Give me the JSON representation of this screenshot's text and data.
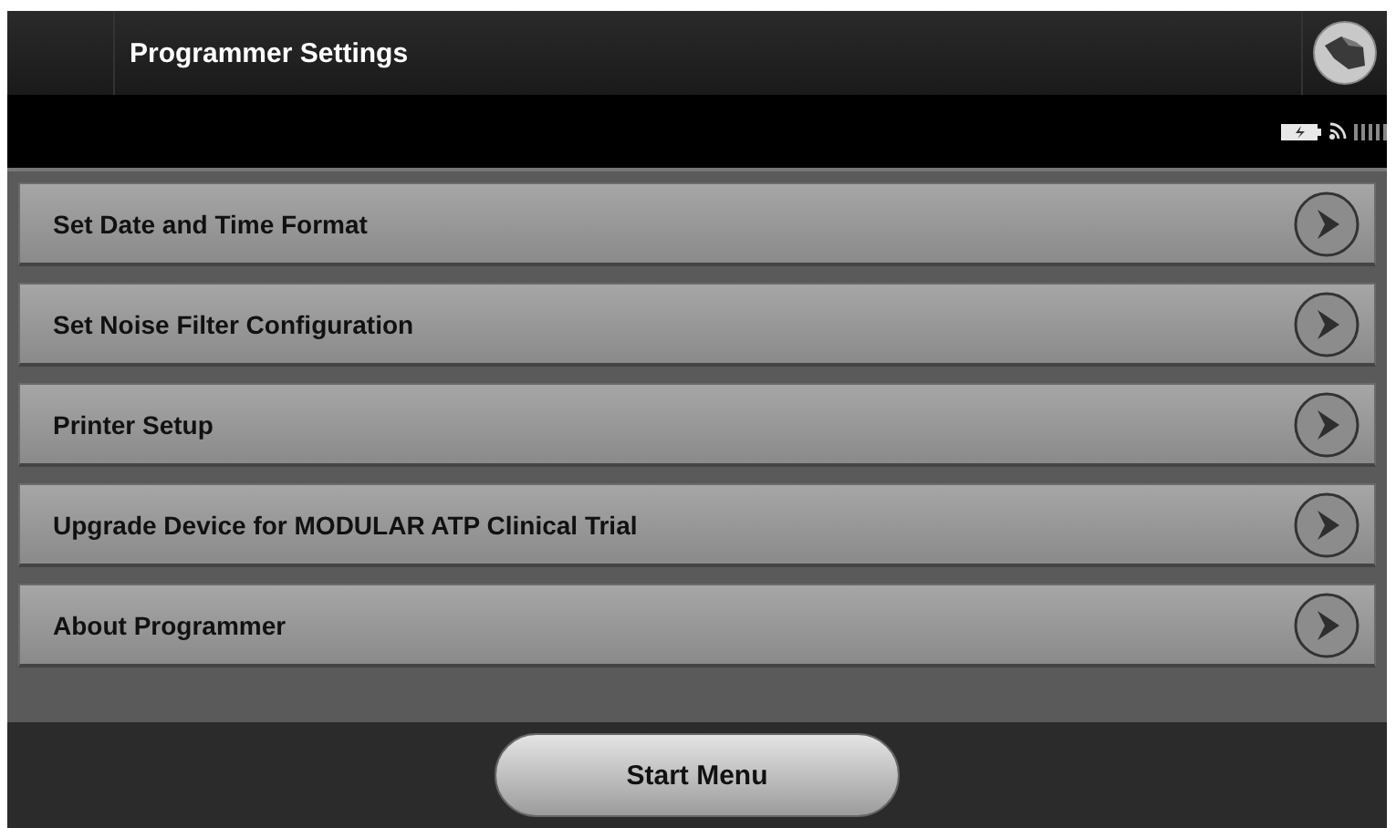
{
  "window": {
    "title": "Programmer Settings"
  },
  "menu_items": [
    {
      "label": "Set Date and Time Format"
    },
    {
      "label": "Set Noise Filter Configuration"
    },
    {
      "label": "Printer Setup"
    },
    {
      "label": "Upgrade Device for MODULAR ATP Clinical Trial"
    },
    {
      "label": "About Programmer"
    }
  ],
  "bottom_bar": {
    "button": "Start Menu"
  }
}
